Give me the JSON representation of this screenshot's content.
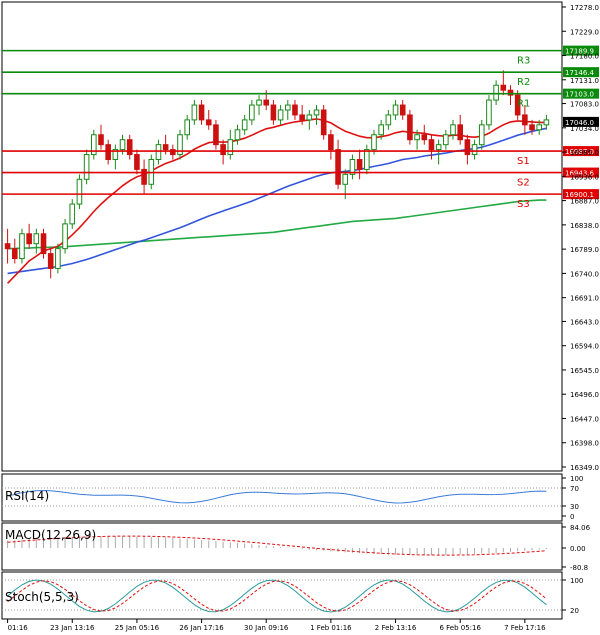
{
  "chart_data": {
    "type": "candlestick",
    "price_axis": {
      "ticks": [
        "17278.0",
        "17229.0",
        "17180.0",
        "17131.0",
        "17083.0",
        "17034.0",
        "16985.0",
        "16936.0",
        "16887.0",
        "16838.0",
        "16789.0",
        "16740.0",
        "16691.0",
        "16643.0",
        "16594.0",
        "16545.0",
        "16496.0",
        "16447.0",
        "16398.0",
        "16349.0"
      ],
      "range": [
        16349,
        17278
      ]
    },
    "x_ticks": [
      "01:16",
      "23 Jan 13:16",
      "25 Jan 05:16",
      "26 Jan 17:16",
      "30 Jan 09:16",
      "1 Feb 01:16",
      "2 Feb 13:16",
      "6 Feb 05:16",
      "7 Feb 17:16"
    ],
    "levels": [
      {
        "name": "R3",
        "value": 17189.9,
        "tag": "17189.9",
        "color": "#0a8a0a"
      },
      {
        "name": "R2",
        "value": 17146.4,
        "tag": "17146.4",
        "color": "#0a8a0a"
      },
      {
        "name": "R1",
        "value": 17103.0,
        "tag": "17103.0",
        "color": "#0a8a0a"
      },
      {
        "name": "S1",
        "value": 16987.0,
        "tag": "16987.0",
        "color": "#e00000"
      },
      {
        "name": "S2",
        "value": 16943.6,
        "tag": "16943.6",
        "color": "#e00000"
      },
      {
        "name": "S3",
        "value": 16900.1,
        "tag": "16900.1",
        "color": "#e00000"
      }
    ],
    "current_price": {
      "value": 17046.0,
      "tag": "17046.0"
    },
    "candles": [
      [
        16800,
        16830,
        16760,
        16790
      ],
      [
        16790,
        16810,
        16760,
        16770
      ],
      [
        16770,
        16830,
        16760,
        16820
      ],
      [
        16820,
        16840,
        16790,
        16800
      ],
      [
        16800,
        16830,
        16780,
        16820
      ],
      [
        16820,
        16830,
        16770,
        16780
      ],
      [
        16780,
        16790,
        16730,
        16750
      ],
      [
        16750,
        16800,
        16740,
        16790
      ],
      [
        16790,
        16850,
        16780,
        16840
      ],
      [
        16840,
        16890,
        16830,
        16880
      ],
      [
        16880,
        16940,
        16870,
        16930
      ],
      [
        16930,
        16990,
        16920,
        16980
      ],
      [
        16980,
        17030,
        16970,
        17020
      ],
      [
        17020,
        17040,
        16990,
        17000
      ],
      [
        17000,
        17010,
        16960,
        16970
      ],
      [
        16970,
        17000,
        16950,
        16990
      ],
      [
        16990,
        17020,
        16980,
        17010
      ],
      [
        17010,
        17020,
        16970,
        16980
      ],
      [
        16980,
        16990,
        16940,
        16950
      ],
      [
        16950,
        16970,
        16900,
        16920
      ],
      [
        16920,
        16980,
        16910,
        16970
      ],
      [
        16970,
        17010,
        16960,
        17000
      ],
      [
        17000,
        17020,
        16980,
        16990
      ],
      [
        16990,
        17000,
        16970,
        16980
      ],
      [
        16980,
        17030,
        16970,
        17020
      ],
      [
        17020,
        17060,
        17010,
        17050
      ],
      [
        17050,
        17090,
        17040,
        17080
      ],
      [
        17080,
        17090,
        17040,
        17050
      ],
      [
        17050,
        17070,
        17030,
        17040
      ],
      [
        17040,
        17050,
        16990,
        17000
      ],
      [
        17000,
        17010,
        16960,
        16980
      ],
      [
        16980,
        17030,
        16970,
        17010
      ],
      [
        17010,
        17040,
        17000,
        17030
      ],
      [
        17030,
        17060,
        17020,
        17050
      ],
      [
        17050,
        17090,
        17040,
        17080
      ],
      [
        17080,
        17100,
        17060,
        17090
      ],
      [
        17090,
        17110,
        17070,
        17080
      ],
      [
        17080,
        17090,
        17040,
        17050
      ],
      [
        17050,
        17080,
        17040,
        17070
      ],
      [
        17070,
        17090,
        17050,
        17080
      ],
      [
        17080,
        17090,
        17050,
        17060
      ],
      [
        17060,
        17080,
        17040,
        17050
      ],
      [
        17050,
        17070,
        17030,
        17060
      ],
      [
        17060,
        17080,
        17040,
        17070
      ],
      [
        17070,
        17080,
        17010,
        17020
      ],
      [
        17020,
        17030,
        16970,
        16990
      ],
      [
        16990,
        17010,
        16910,
        16920
      ],
      [
        16920,
        16950,
        16890,
        16940
      ],
      [
        16940,
        16980,
        16930,
        16970
      ],
      [
        16970,
        16990,
        16930,
        16950
      ],
      [
        16950,
        17000,
        16940,
        16990
      ],
      [
        16990,
        17030,
        16980,
        17020
      ],
      [
        17020,
        17050,
        17010,
        17040
      ],
      [
        17040,
        17070,
        17030,
        17060
      ],
      [
        17060,
        17090,
        17050,
        17080
      ],
      [
        17080,
        17090,
        17050,
        17060
      ],
      [
        17060,
        17070,
        17000,
        17010
      ],
      [
        17010,
        17030,
        16990,
        17020
      ],
      [
        17020,
        17040,
        17000,
        17010
      ],
      [
        17010,
        17020,
        16970,
        16990
      ],
      [
        16990,
        17010,
        16960,
        17000
      ],
      [
        17000,
        17030,
        16990,
        17020
      ],
      [
        17020,
        17050,
        17010,
        17040
      ],
      [
        17040,
        17060,
        17000,
        17010
      ],
      [
        17010,
        17020,
        16960,
        16980
      ],
      [
        16980,
        17010,
        16970,
        17000
      ],
      [
        17000,
        17050,
        16990,
        17040
      ],
      [
        17040,
        17100,
        17030,
        17090
      ],
      [
        17090,
        17130,
        17080,
        17120
      ],
      [
        17120,
        17150,
        17100,
        17110
      ],
      [
        17110,
        17120,
        17080,
        17100
      ],
      [
        17100,
        17110,
        17050,
        17060
      ],
      [
        17060,
        17080,
        17020,
        17040
      ],
      [
        17040,
        17050,
        17020,
        17030
      ],
      [
        17030,
        17050,
        17020,
        17040
      ],
      [
        17040,
        17060,
        17030,
        17050
      ]
    ],
    "ma_fast": [
      16720,
      16735,
      16750,
      16765,
      16775,
      16785,
      16790,
      16795,
      16805,
      16818,
      16832,
      16848,
      16865,
      16880,
      16893,
      16905,
      16917,
      16927,
      16935,
      16940,
      16947,
      16955,
      16962,
      16967,
      16973,
      16981,
      16991,
      16998,
      17004,
      17006,
      17005,
      17006,
      17009,
      17013,
      17019,
      17026,
      17032,
      17035,
      17039,
      17043,
      17046,
      17048,
      17050,
      17052,
      17049,
      17044,
      17035,
      17027,
      17022,
      17017,
      17014,
      17014,
      17016,
      17019,
      17024,
      17027,
      17025,
      17024,
      17023,
      17020,
      17018,
      17017,
      17019,
      17019,
      17016,
      17015,
      17017,
      17023,
      17032,
      17040,
      17046,
      17048,
      17047,
      17046,
      17045,
      17045
    ],
    "ma_mid": [
      16740,
      16742,
      16744,
      16746,
      16748,
      16750,
      16752,
      16754,
      16757,
      16760,
      16764,
      16768,
      16773,
      16778,
      16783,
      16788,
      16793,
      16798,
      16803,
      16807,
      16812,
      16817,
      16822,
      16827,
      16832,
      16838,
      16844,
      16850,
      16856,
      16861,
      16866,
      16871,
      16876,
      16881,
      16886,
      16892,
      16898,
      16904,
      16910,
      16916,
      16921,
      16926,
      16931,
      16936,
      16940,
      16943,
      16945,
      16946,
      16948,
      16950,
      16953,
      16956,
      16959,
      16962,
      16966,
      16970,
      16972,
      16974,
      16977,
      16979,
      16981,
      16983,
      16986,
      16988,
      16990,
      16992,
      16995,
      16999,
      17004,
      17009,
      17014,
      17019,
      17023,
      17027,
      17030,
      17033
    ],
    "ma_slow": [
      16790,
      16790,
      16791,
      16791,
      16792,
      16792,
      16793,
      16793,
      16794,
      16795,
      16796,
      16797,
      16798,
      16799,
      16800,
      16801,
      16802,
      16803,
      16804,
      16805,
      16806,
      16807,
      16808,
      16809,
      16810,
      16811,
      16812,
      16813,
      16814,
      16815,
      16816,
      16817,
      16818,
      16819,
      16820,
      16821,
      16822,
      16823,
      16825,
      16827,
      16829,
      16831,
      16833,
      16835,
      16837,
      16839,
      16841,
      16843,
      16845,
      16846,
      16847,
      16848,
      16849,
      16850,
      16851,
      16853,
      16855,
      16857,
      16859,
      16861,
      16863,
      16865,
      16867,
      16869,
      16871,
      16873,
      16875,
      16877,
      16879,
      16881,
      16883,
      16885,
      16886,
      16887,
      16888,
      16888
    ]
  },
  "indicators": {
    "rsi": {
      "label": "RSI(14)",
      "ticks": [
        "100",
        "70",
        "30",
        "0"
      ]
    },
    "macd": {
      "label": "MACD(12,26,9)",
      "ticks": [
        "84.06",
        "0.00",
        "-80.8"
      ]
    },
    "stoch": {
      "label": "Stoch(5,5,3)",
      "ticks": [
        "100",
        "20"
      ]
    }
  }
}
